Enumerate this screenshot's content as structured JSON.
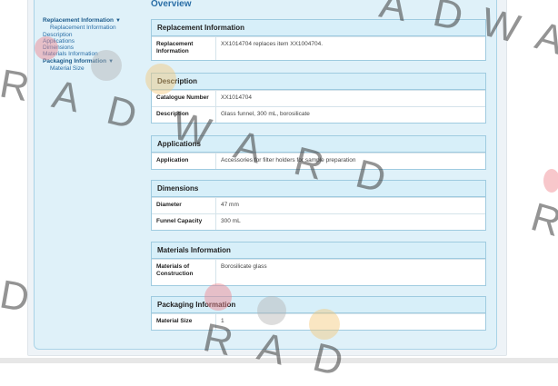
{
  "overview_title": "Overview",
  "sidebar": {
    "items": [
      {
        "label": "Replacement Information",
        "head": true,
        "arrow": "▼"
      },
      {
        "label": "Replacement Information",
        "sub": true
      },
      {
        "label": "Description"
      },
      {
        "label": "Applications"
      },
      {
        "label": "Dimensions"
      },
      {
        "label": "Materials Information"
      },
      {
        "label": "Packaging Information",
        "head": true,
        "arrow": "▼"
      },
      {
        "label": "Material Size",
        "sub": true
      }
    ]
  },
  "sections": [
    {
      "title": "Replacement Information",
      "rows": [
        {
          "label": "Replacement Information",
          "value": "XX1014704 replaces item XX1004704."
        }
      ]
    },
    {
      "title": "Description",
      "rows": [
        {
          "label": "Catalogue Number",
          "value": "XX1014704"
        },
        {
          "label": "Description",
          "value": "Glass funnel, 300 mL, borosilicate"
        }
      ]
    },
    {
      "title": "Applications",
      "rows": [
        {
          "label": "Application",
          "value": "Accessories for filter holders for sample preparation"
        }
      ]
    },
    {
      "title": "Dimensions",
      "rows": [
        {
          "label": "Diameter",
          "value": "47 mm"
        },
        {
          "label": "Funnel Capacity",
          "value": "300 mL"
        }
      ]
    },
    {
      "title": "Materials Information",
      "rows": [
        {
          "label": "Materials of Construction",
          "value": "Borosilicate glass"
        }
      ]
    },
    {
      "title": "Packaging Information",
      "rows": [
        {
          "label": "Material Size",
          "value": "1"
        }
      ]
    }
  ],
  "watermark_text": [
    "A",
    "D",
    "W",
    "A",
    "R",
    "A",
    "D",
    "W",
    "A",
    "R",
    "D",
    "R",
    "D",
    "R",
    "A",
    "D"
  ]
}
